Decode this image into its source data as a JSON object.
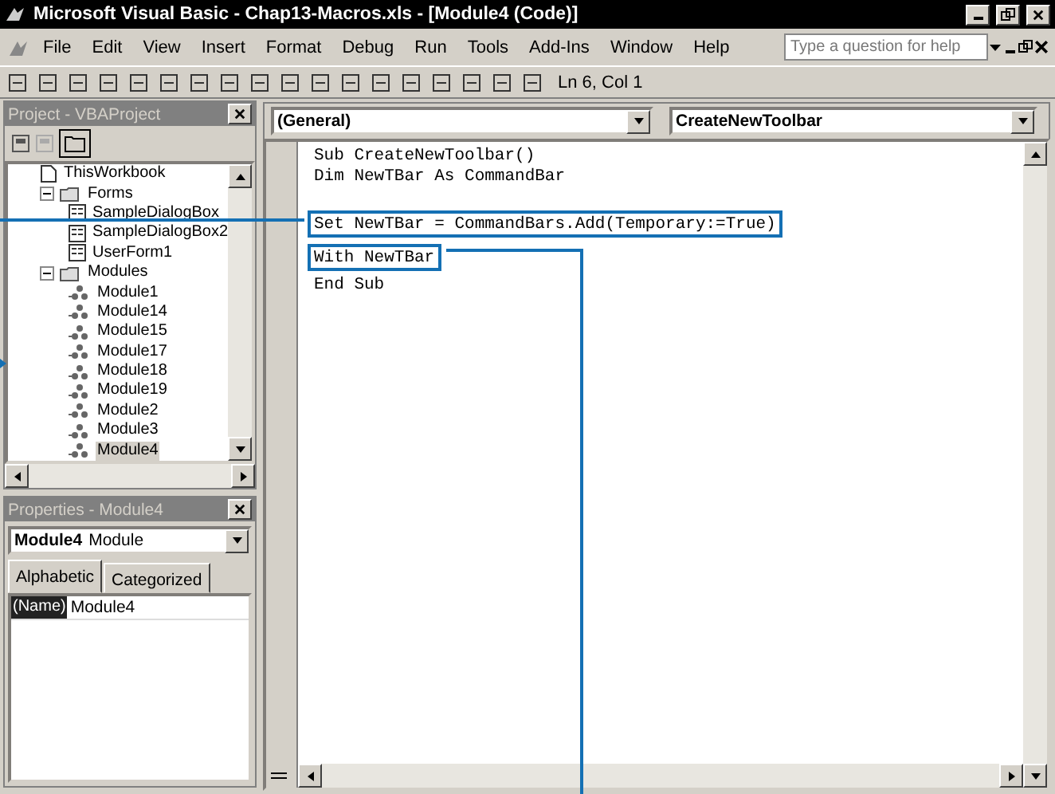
{
  "window": {
    "title": "Microsoft Visual Basic - Chap13-Macros.xls - [Module4 (Code)]"
  },
  "menu": [
    "File",
    "Edit",
    "View",
    "Insert",
    "Format",
    "Debug",
    "Run",
    "Tools",
    "Add-Ins",
    "Window",
    "Help"
  ],
  "help_box": {
    "placeholder": "Type a question for help"
  },
  "toolbar": {
    "position": "Ln 6, Col 1"
  },
  "project_pane": {
    "title": "Project - VBAProject",
    "tree": [
      {
        "label": "ThisWorkbook",
        "kind": "workbook",
        "selected": false
      },
      {
        "label": "Forms",
        "kind": "folder",
        "expanded": true,
        "selected": false,
        "children": [
          {
            "label": "SampleDialogBox",
            "kind": "form",
            "selected": false
          },
          {
            "label": "SampleDialogBox2",
            "kind": "form",
            "selected": false
          },
          {
            "label": "UserForm1",
            "kind": "form",
            "selected": false
          }
        ]
      },
      {
        "label": "Modules",
        "kind": "folder",
        "expanded": true,
        "selected": false,
        "children": [
          {
            "label": "Module1",
            "kind": "module",
            "selected": false
          },
          {
            "label": "Module14",
            "kind": "module",
            "selected": false
          },
          {
            "label": "Module15",
            "kind": "module",
            "selected": false
          },
          {
            "label": "Module17",
            "kind": "module",
            "selected": false
          },
          {
            "label": "Module18",
            "kind": "module",
            "selected": false
          },
          {
            "label": "Module19",
            "kind": "module",
            "selected": false
          },
          {
            "label": "Module2",
            "kind": "module",
            "selected": false
          },
          {
            "label": "Module3",
            "kind": "module",
            "selected": false
          },
          {
            "label": "Module4",
            "kind": "module",
            "selected": true
          }
        ]
      }
    ]
  },
  "properties_pane": {
    "title": "Properties - Module4",
    "object": {
      "name": "Module4",
      "type": "Module"
    },
    "tabs": [
      {
        "label": "Alphabetic",
        "selected": true
      },
      {
        "label": "Categorized",
        "selected": false
      }
    ],
    "properties": [
      {
        "name": "(Name)",
        "value": "Module4",
        "selected": true
      }
    ]
  },
  "code_window": {
    "object_dropdown": "(General)",
    "procedure_dropdown": "CreateNewToolbar",
    "lines": [
      {
        "kind": "code",
        "text": "Sub CreateNewToolbar()",
        "highlighted": false
      },
      {
        "kind": "code",
        "text": "Dim NewTBar As CommandBar",
        "highlighted": false
      },
      {
        "kind": "blank"
      },
      {
        "kind": "code",
        "text": "Set NewTBar = CommandBars.Add(Temporary:=True)",
        "highlighted": true
      },
      {
        "kind": "code",
        "text": "With NewTBar",
        "highlighted": true
      },
      {
        "kind": "code",
        "text": "End Sub",
        "highlighted": false
      }
    ]
  }
}
